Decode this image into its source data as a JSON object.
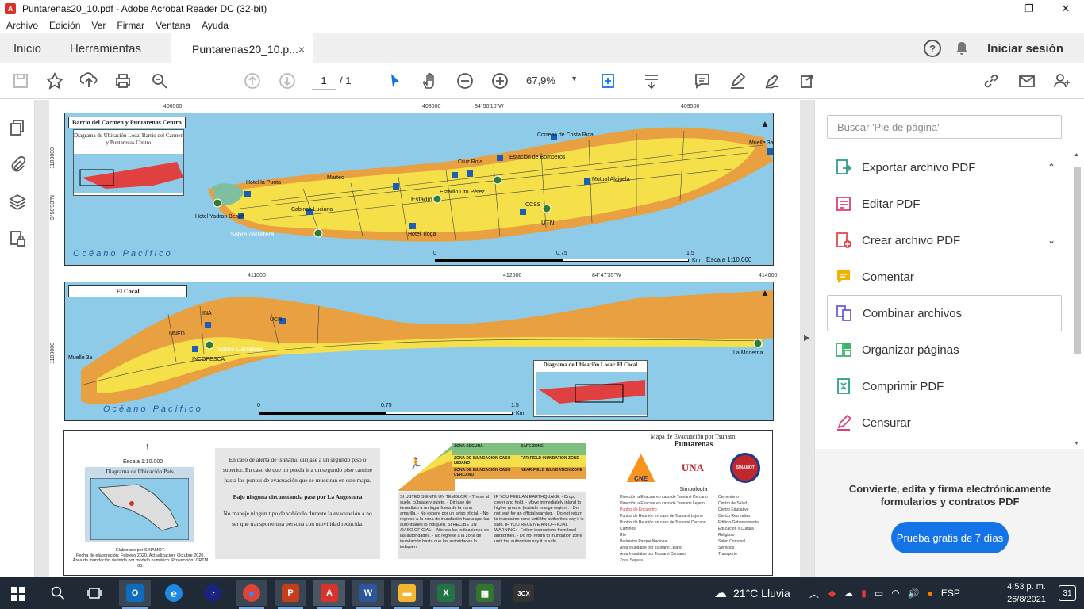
{
  "window": {
    "title": "Puntarenas20_10.pdf - Adobe Acrobat Reader DC (32-bit)",
    "minimize": "—",
    "maximize": "❐",
    "close": "✕"
  },
  "menu": [
    "Archivo",
    "Edición",
    "Ver",
    "Firmar",
    "Ventana",
    "Ayuda"
  ],
  "tabs": {
    "home": "Inicio",
    "tools": "Herramientas",
    "document": "Puntarenas20_10.p...",
    "document_close": "×",
    "sign_in": "Iniciar sesión",
    "help": "?"
  },
  "toolbar": {
    "current_page": "1",
    "total_pages": "/ 1",
    "zoom": "67,9%",
    "zoom_arrow": "▼"
  },
  "map": {
    "panel1": {
      "title": "Barrio del Carmen y Puntarenas Centro",
      "inset_title": "Diagrama de Ubicación Local\nBarrio del Carmen y Puntarenas Centro",
      "coords_top": [
        "406500",
        "408000",
        "84°50'10\"W",
        "409500"
      ],
      "coords_left": [
        "1103000",
        "9°58'33\"N"
      ],
      "labels": [
        "Correos de Costa Rica",
        "Estación de Bomberos",
        "Cruz Roja",
        "Mutual Alajuela",
        "Martec",
        "Hotel la Punta",
        "Estadio",
        "Estadio Lito Pérez",
        "CCSS",
        "UTN",
        "Cabinas Luciana",
        "Hotel Yadran Beach",
        "Sobre carretera",
        "Hotel Tioga",
        "Muelle 3a"
      ],
      "ocean": "Océano Pacífico",
      "scale_ticks": [
        "0",
        "0.75",
        "1.5"
      ],
      "scale_unit": "Km",
      "scale_text": "Escala  1:10,000"
    },
    "panel2": {
      "title": "El Cocal",
      "coords_top": [
        "411000",
        "412500",
        "84°47'35\"W",
        "414000"
      ],
      "coords_left": [
        "1103000"
      ],
      "labels": [
        "INA",
        "UCR",
        "UNED",
        "INCOPESCA",
        "Sobre Carretera",
        "Muelle 3a",
        "La Moderna"
      ],
      "ocean": "Océano Pacífico",
      "inset_title": "Diagrama de Ubicación Local: El Cocal",
      "scale_ticks": [
        "0",
        "0.75",
        "1.5"
      ],
      "scale_unit": "Km"
    },
    "legend": {
      "scale": "Escala 1:10.000",
      "country_diagram": "Diagrama de Ubicación País",
      "credits": "Elaborado por SINAMOT.\nFecha de elaboración: Febrero 2020. Actualización: Octubre 2020.\nÁrea de inundación definida por modelo numérico. Proyección: CRTM 05.",
      "instructions_1": "En caso de alerta de tsunami, diríjase a un segundo piso o superior. En caso de que no pueda ir a un segundo piso camine hasta los puntos de evacuación que se muestran en  este mapa.",
      "instructions_2": "Bajo ninguna circunstancia pase por La Angostura",
      "instructions_3": "No maneje ningún tipo de vehículo durante la evacuación a no ser que transporte una persona con movilidad reducida.",
      "zones": [
        {
          "es": "ZONA SEGURA",
          "en": "SAFE ZONE",
          "color": "#7fbf7f"
        },
        {
          "es": "ZONA DE INUNDACIÓN CASO LEJANO",
          "en": "FAR-FIELD INUNDATION ZONE",
          "color": "#f5e04a"
        },
        {
          "es": "ZONA DE INUNDACIÓN CASO CERCANO",
          "en": "NEAR-FIELD INUNDATION ZONE",
          "color": "#e8a040"
        }
      ],
      "eq_es": "SI USTED SIENTE UN TEMBLOR: - Tírese al suelo, cúbrase y sujete. - Diríjase de inmediato a un lugar fuera de la zona amarilla. - No espere por un aviso oficial. - No regrese a la zona de inundación hasta que las autoridades lo indiquen. SI RECIBE UN AVISO OFICIAL: - Atienda las indicaciones de las autoridades. - No regrese a la zona de inundación hasta que las autoridades lo indiquen.",
      "eq_en": "IF YOU FEEL AN EARTHQUAKE: - Drop, cover and hold. - Move immediately inland to higher ground (outside orange region). - Do not wait for an official warning. - Do not return to inundation zone until the authorities say it is safe. IF YOU RECEIVE AN OFFICIAL WARNING: - Follow instructions from local authorities. - Do not return to inundation zone until the authorities say it is safe.",
      "symb_title": "Mapa de Evacuación por Tsunami",
      "symb_place": "Puntarenas",
      "symb_heading": "Simbología",
      "logos": [
        "CNE",
        "UNA",
        "SINAMOT"
      ],
      "symbols_left": [
        "Dirección a Evacuar en caso de Tsunami Cercano",
        "Dirección a Evacuar en caso de Tsunami Lejano",
        "Puntos de Encuentro",
        "Puntos de Reunión en caso de Tsunami Lejano",
        "Puntos de Reunión en caso de Tsunami Cercano",
        "Caminos",
        "Río",
        "Perímetro Parque Nacional",
        "Área Inundable por Tsunami Lejano",
        "Área Inundable por Tsunami Cercano",
        "Zona Segura"
      ],
      "symbols_right": [
        "Cementerio",
        "Centro de Salud",
        "Centro Educativo",
        "Centro Recreativo",
        "Edificio Gubernamental",
        "Educación y Cultura",
        "Religioso",
        "Salón Comunal",
        "Servicios",
        "Transporte"
      ]
    }
  },
  "right_panel": {
    "search_placeholder": "Buscar 'Pie de página'",
    "tools": [
      {
        "label": "Exportar archivo PDF",
        "chevron": "⌃",
        "color": "#2d9f8b"
      },
      {
        "label": "Editar PDF",
        "chevron": "",
        "color": "#e0407a"
      },
      {
        "label": "Crear archivo PDF",
        "chevron": "⌄",
        "color": "#e34850"
      },
      {
        "label": "Comentar",
        "chevron": "",
        "color": "#f0b400"
      },
      {
        "label": "Combinar archivos",
        "chevron": "",
        "color": "#6c5fd6"
      },
      {
        "label": "Organizar páginas",
        "chevron": "",
        "color": "#3bb56b"
      },
      {
        "label": "Comprimir PDF",
        "chevron": "",
        "color": "#2d9f8b"
      },
      {
        "label": "Censurar",
        "chevron": "",
        "color": "#e0407a"
      }
    ],
    "promo_text": "Convierte, edita y firma electrónicamente formularios y contratos PDF",
    "trial_button": "Prueba gratis de 7 días"
  },
  "taskbar": {
    "apps": [
      {
        "name": "Outlook",
        "glyph": "O",
        "color": "#0f6cbd"
      },
      {
        "name": "Internet Explorer",
        "glyph": "e",
        "color": "#1e88e5"
      },
      {
        "name": "App",
        "glyph": "◔",
        "color": "#1a237e"
      },
      {
        "name": "Chrome",
        "glyph": "●",
        "color": "#db4437"
      },
      {
        "name": "PowerPoint",
        "glyph": "P",
        "color": "#c43e1c"
      },
      {
        "name": "Acrobat",
        "glyph": "A",
        "color": "#d9322a"
      },
      {
        "name": "Word",
        "glyph": "W",
        "color": "#2b579a"
      },
      {
        "name": "File Explorer",
        "glyph": "▬",
        "color": "#f2b630"
      },
      {
        "name": "Excel",
        "glyph": "X",
        "color": "#217346"
      },
      {
        "name": "Project",
        "glyph": "▦",
        "color": "#31752f"
      },
      {
        "name": "3CX",
        "glyph": "3CX",
        "color": "#333"
      }
    ],
    "weather": "21°C  Lluvia",
    "language": "ESP",
    "time": "4:53 p. m.",
    "date": "26/8/2021",
    "notifications": "31"
  }
}
